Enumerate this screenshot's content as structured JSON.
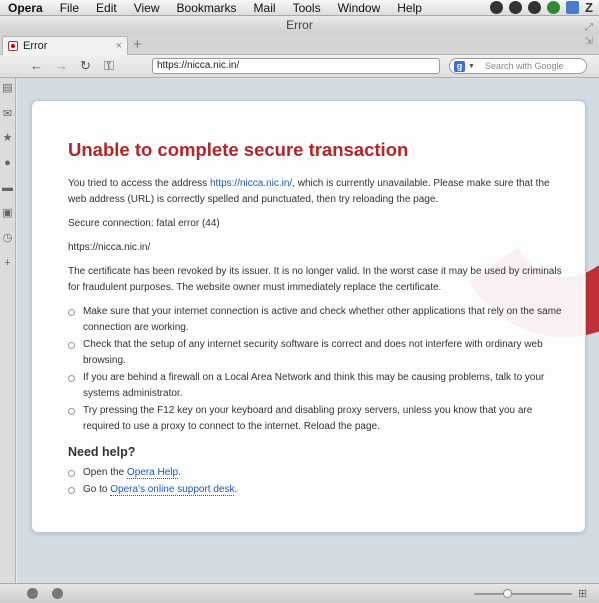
{
  "menubar": {
    "app": "Opera",
    "items": [
      "File",
      "Edit",
      "View",
      "Bookmarks",
      "Mail",
      "Tools",
      "Window",
      "Help"
    ],
    "status_icons": [
      "help-circle-icon",
      "mail-badge-icon",
      "download-icon",
      "evernote-icon",
      "dropbox-icon",
      "z-icon"
    ],
    "z_glyph": "Z"
  },
  "window": {
    "title": "Error"
  },
  "tabs": [
    {
      "label": "Error"
    }
  ],
  "tab_close": "×",
  "new_tab": "+",
  "toolbar": {
    "back": "←",
    "forward": "→",
    "reload": "↻",
    "key": "⚿",
    "url": "https://nicca.nic.in/",
    "search_engine": "g",
    "search_placeholder": "Search with Google"
  },
  "error": {
    "title": "Unable to complete secure transaction",
    "intro_before": "You tried to access the address ",
    "intro_link": "https://nicca.nic.in/",
    "intro_after": ", which is currently unavailable. Please make sure that the web address (URL) is correctly spelled and punctuated, then try reloading the page.",
    "secure_status": "Secure connection: fatal error (44)",
    "url_line": "https://nicca.nic.in/",
    "certificate_msg": "The certificate has been revoked by its issuer. It is no longer valid. In the worst case it may be used by criminals for fraudulent purposes. The website owner must immediately replace the certificate.",
    "suggestions": [
      "Make sure that your internet connection is active and check whether other applications that rely on the same connection are working.",
      "Check that the setup of any internet security software is correct and does not interfere with ordinary web browsing.",
      "If you are behind a firewall on a Local Area Network and think this may be causing problems, talk to your systems administrator.",
      "Try pressing the F12 key on your keyboard and disabling proxy servers, unless you know that you are required to use a proxy to connect to the internet. Reload the page."
    ],
    "help_heading": "Need help?",
    "help_1_before": "Open the ",
    "help_1_link": "Opera Help",
    "help_1_after": ".",
    "help_2_before": "Go to ",
    "help_2_link": "Opera's online support desk",
    "help_2_after": "."
  },
  "colors": {
    "title_red": "#b0262a",
    "link_blue": "#1a58b4",
    "swoosh_red": "#c0272d"
  }
}
